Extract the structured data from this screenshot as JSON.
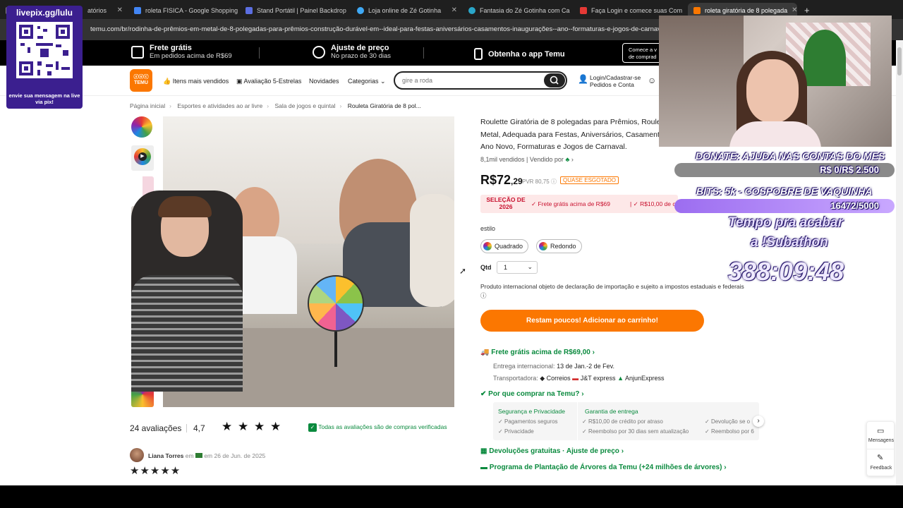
{
  "tabs": [
    {
      "title": "atórios",
      "color": "#e0e0e0"
    },
    {
      "title": "roleta FISICA - Google Shopping",
      "color": "#4285f4"
    },
    {
      "title": "Stand Portátil | Painel Backdrop",
      "color": "#5b6ee1"
    },
    {
      "title": "Loja online de Zé Gotinha",
      "color": "#3fa9f5"
    },
    {
      "title": "Fantasia do Zé Gotinha com Ca",
      "color": "#2aa6c9"
    },
    {
      "title": "Faça Login e comece suas Com",
      "color": "#e53935"
    },
    {
      "title": "roleta giratória de 8 polegada",
      "color": "#fb7701"
    }
  ],
  "url": "temu.com/br/rodinha-de-prêmios-em-metal-de-8-polegadas-para-prêmios-construção-durável-em--ideal-para-festas-aniversários-casamentos-inaugurações--ano--formaturas-e-jogos-de-carnava",
  "promo": {
    "shipping_title": "Frete grátis",
    "shipping_sub": "Em pedidos acima de R$69",
    "price_title": "Ajuste de preço",
    "price_sub": "No prazo de 30 dias",
    "app": "Obtenha o app Temu",
    "cta_line1": "Comece a v",
    "cta_line2": "de comprad"
  },
  "nav": {
    "logo_top": "ⓢⓤⓒ",
    "logo_bottom": "TEMU",
    "best_sellers": "Itens mais vendidos",
    "five_star": "Avaliação 5-Estrelas",
    "new": "Novidades",
    "categories": "Categorias",
    "search_placeholder": "gire a roda",
    "login_line1": "Login/Cadastrar-se",
    "login_line2": "Pedidos e Conta"
  },
  "breadcrumb": [
    "Página inicial",
    "Esportes e atividades ao ar livre",
    "Sala de jogos e quintal",
    "Rouleta Giratória de 8 pol..."
  ],
  "product": {
    "title": "Roulette Giratória de 8 polegadas para Prêmios, Roulet Metal, Adequada para Festas, Aniversários, Casament Natal, Ano Novo, Formaturas e Jogos de Carnaval.",
    "sold": "8,1mil vendidos",
    "sold_by": "Vendido por",
    "price_main": "R$72",
    "price_cents": ",29",
    "rrp": "PVR 80,75",
    "esgotado": "QUASE ESGOTADO",
    "selecao": "SELEÇÃO DE 2026",
    "sel_item1": "Frete grátis acima de R$69",
    "sel_item2": "R$10,00 de c",
    "style_label": "estilo",
    "options": [
      "Quadrado",
      "Redondo"
    ],
    "qty_label": "Qtd",
    "qty_value": "1",
    "notice": "Produto internacional objeto de declaração de importação e sujeito a impostos estaduais e federais",
    "cart_button": "Restam poucos! Adicionar ao carrinho!",
    "free_ship": "Frete grátis acima de R$69,00",
    "delivery_label": "Entrega internacional:",
    "delivery_value": "13 de Jan.-2 de Fev.",
    "carriers_label": "Transportadora:",
    "carriers": [
      "Correios",
      "J&T express",
      "AnjunExpress"
    ],
    "why": "Por que comprar na Temu?",
    "why_col1_title": "Segurança e Privacidade",
    "why_col1_items": [
      "Pagamentos seguros",
      "Privacidade"
    ],
    "why_col2_title": "Garantia de entrega",
    "why_col2_items": [
      "R$10,00 de crédito por atraso",
      "Reembolso por 30 dias sem atualização"
    ],
    "why_col3_items": [
      "Devolução se o",
      "Reembolso por 6"
    ],
    "returns": "Devoluções gratuitas · Ajuste de preço",
    "trees": "Programa de Plantação de Árvores da Temu (+24 milhões de árvores)"
  },
  "reviews": {
    "count": "24 avaliações",
    "score": "4,7",
    "rating": 4.7,
    "verified": "Todas as avaliações são de compras verificadas",
    "reviewer": "Liana Torres",
    "review_date_prefix": "em",
    "review_date": "em 26 de Jun. de 2025"
  },
  "sidebar": {
    "messages": "Mensagens",
    "feedback": "Feedback"
  },
  "overlay": {
    "qr_head": "livepix.gg/lulu",
    "qr_foot": "envie sua mensagem na live via pix!",
    "donate": "DONATE: AJUDA NAS CONTAS DO MES",
    "donate_value": "R$ 0/R$ 2.500",
    "bits": "BITS:  5k - COSPOBRE DE VAQUINHA",
    "bits_value": "16472/5000",
    "timer_label_1": "Tempo pra acabar",
    "timer_label_2": "a !Subathon",
    "timer": "388:09:48"
  },
  "colors": {
    "accent": "#fb7701",
    "green": "#0a8a3e",
    "overlay_purple": "#3b1f8f"
  }
}
